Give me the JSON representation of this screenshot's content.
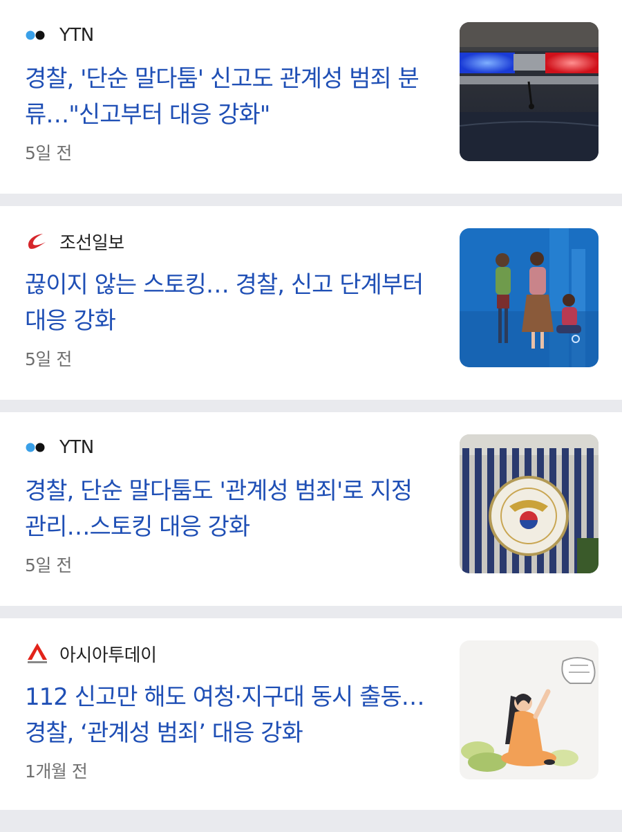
{
  "articles": [
    {
      "source": "YTN",
      "logo_icon": "ytn-dots-logo",
      "headline": "경찰, '단순 말다툼' 신고도 관계성 범죄 분류…\"신고부터 대응 강화\"",
      "time": "5일 전",
      "thumbnail": "police-car-lightbar-photo"
    },
    {
      "source": "조선일보",
      "logo_icon": "chosun-swoosh-logo",
      "headline": "끊이지 않는 스토킹… 경찰, 신고 단계부터 대응 강화",
      "time": "5일 전",
      "thumbnail": "stalking-illustration"
    },
    {
      "source": "YTN",
      "logo_icon": "ytn-dots-logo",
      "headline": "경찰, 단순 말다툼도 '관계성 범죄'로 지정 관리…스토킹 대응 강화",
      "time": "5일 전",
      "thumbnail": "police-emblem-building-photo"
    },
    {
      "source": "아시아투데이",
      "logo_icon": "asiatoday-a-logo",
      "headline": "112 신고만 해도 여청·지구대 동시 출동…경찰, ‘관계성 범죄’ 대응 강화",
      "time": "1개월 전",
      "thumbnail": "woman-fist-illustration"
    }
  ],
  "colors": {
    "headline": "#1f4fb5",
    "divider": "#e9eaee",
    "meta_text": "#6f6f6f"
  }
}
